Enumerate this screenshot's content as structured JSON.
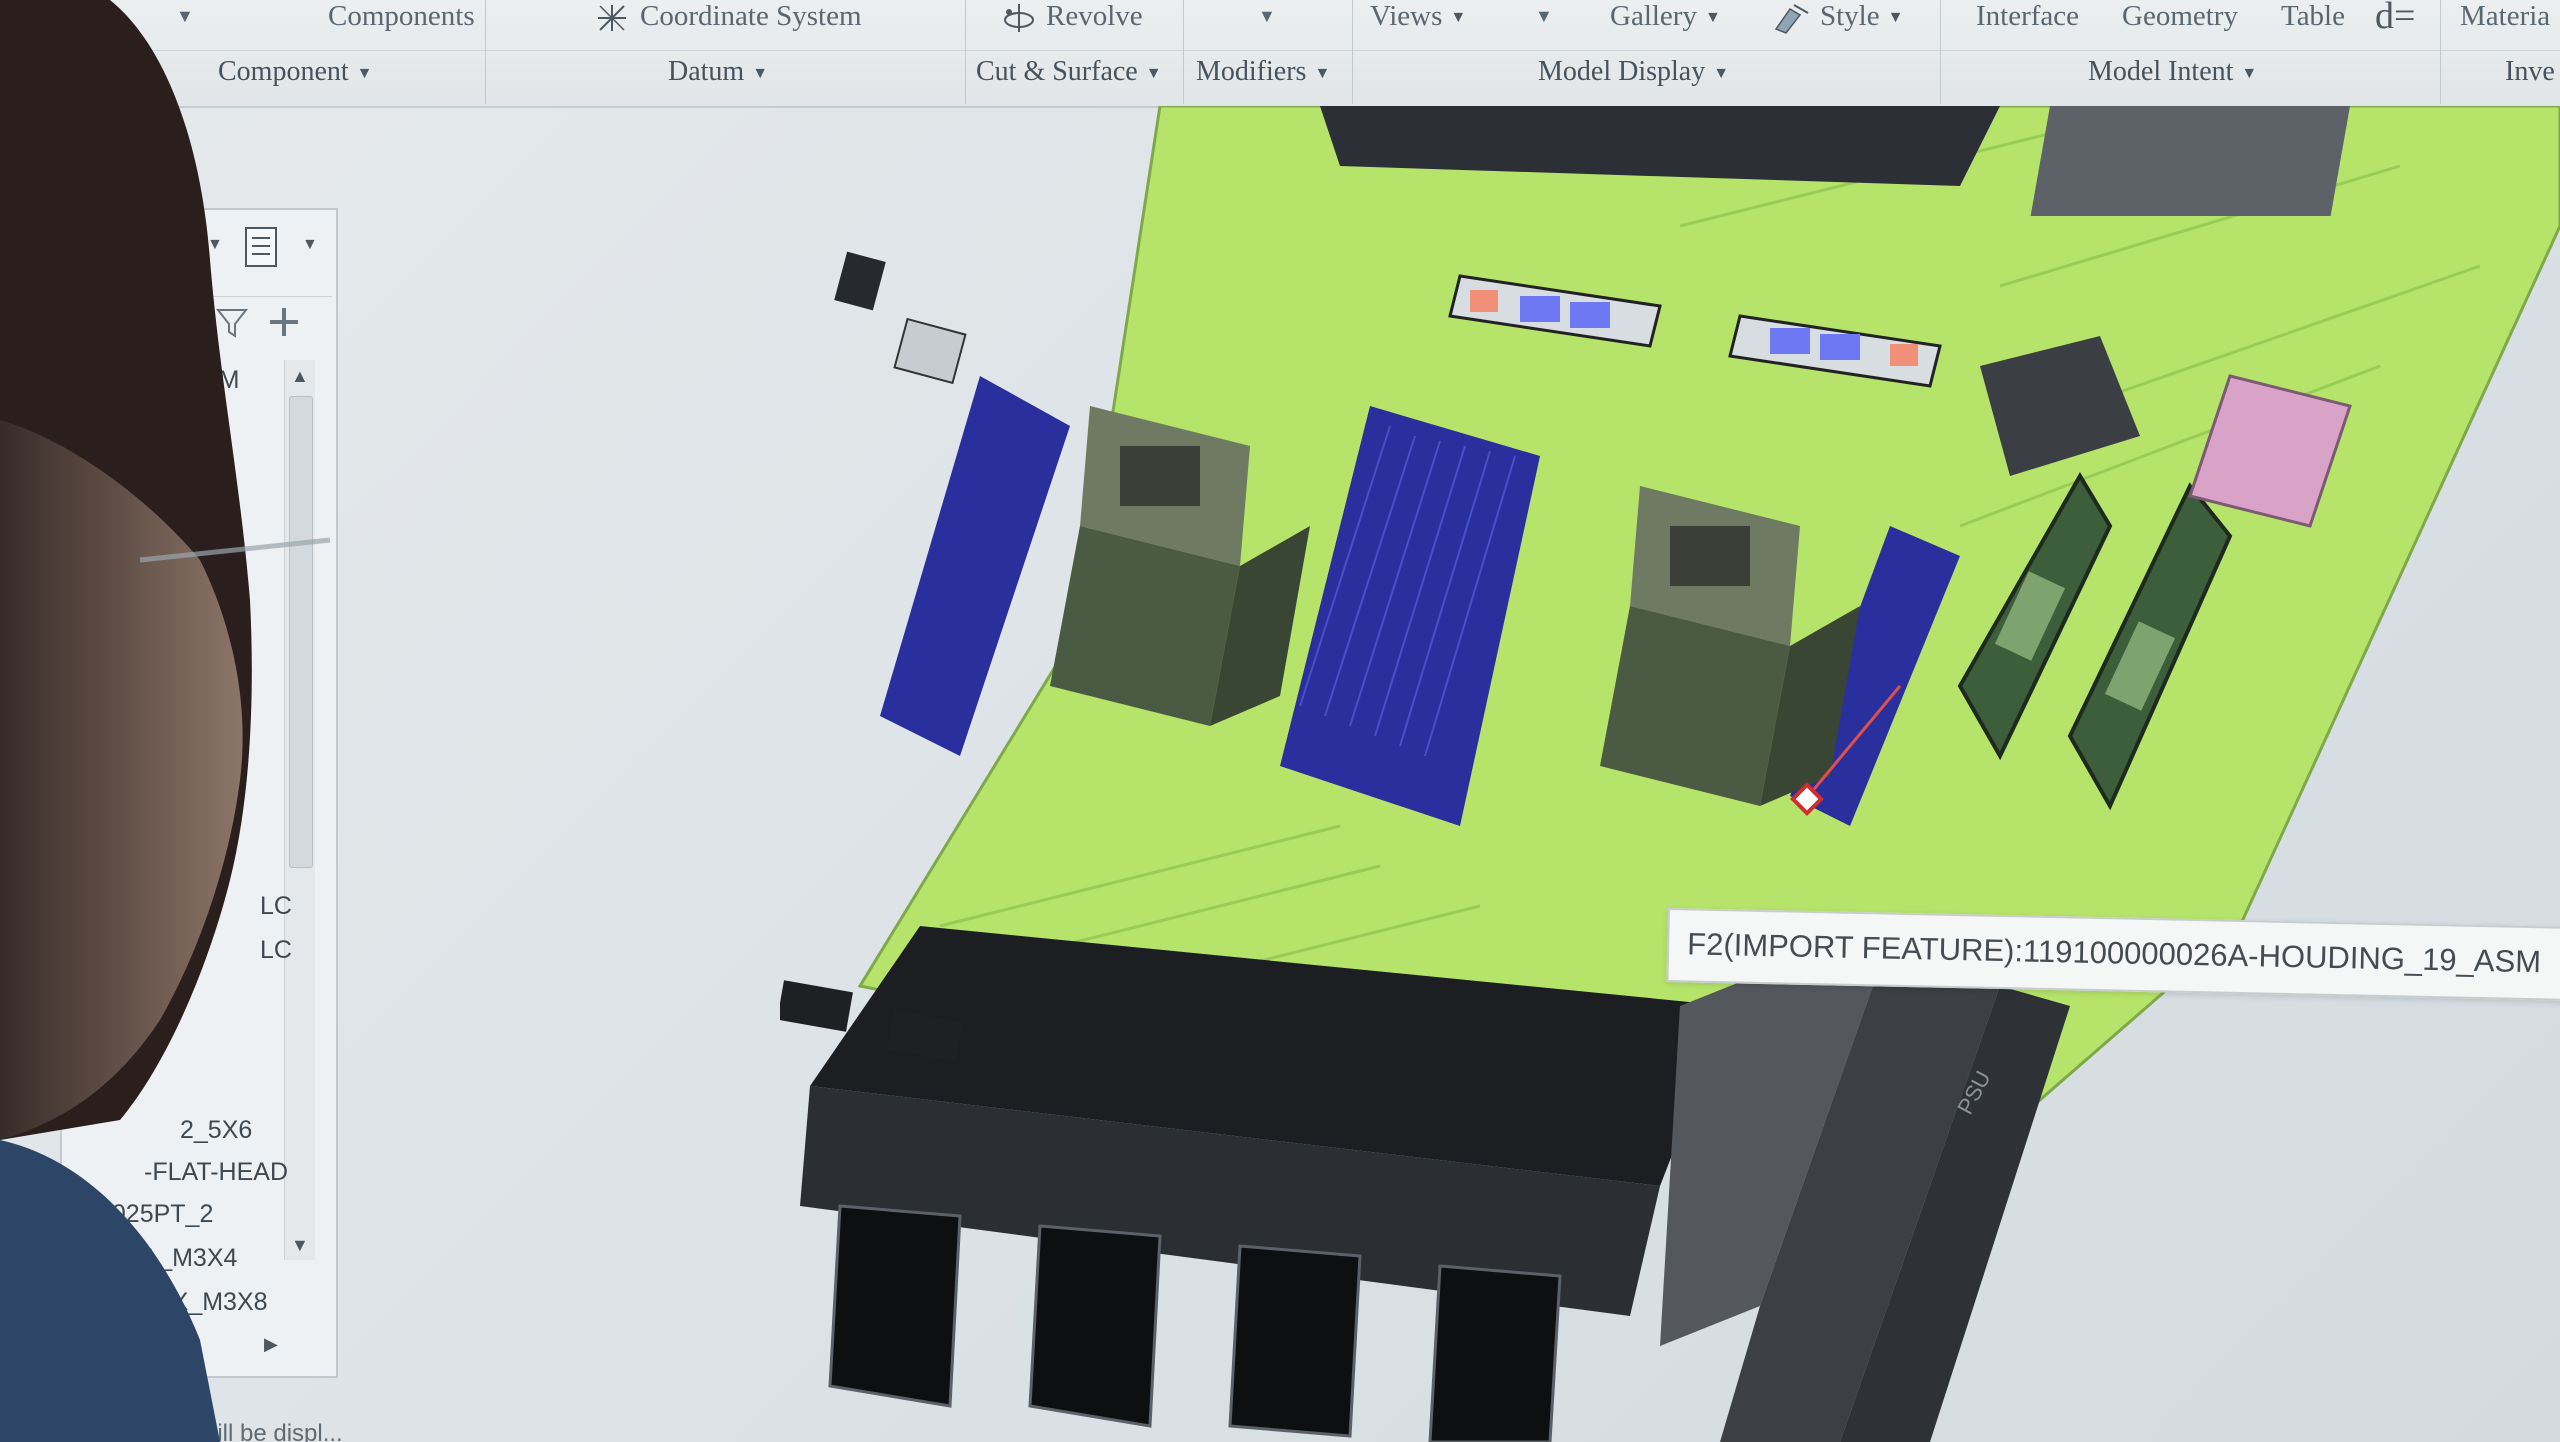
{
  "ribbon": {
    "row1": {
      "components": "Components",
      "coordinate_system": "Coordinate System",
      "revolve": "Revolve",
      "views": "Views",
      "gallery": "Gallery",
      "style": "Style",
      "interface": "Interface",
      "geometry": "Geometry",
      "table": "Table",
      "materials": "Materia"
    },
    "groups": {
      "component": "Component",
      "datum": "Datum",
      "cut_surface": "Cut & Surface",
      "modifiers": "Modifiers",
      "model_display": "Model Display",
      "model_intent": "Model Intent",
      "investigate": "Inve"
    }
  },
  "graphics_toolbar": {
    "buttons": [
      "refit",
      "zoom-in",
      "zoom-out",
      "repaint",
      "saved-orientations",
      "annotation-display",
      "view-manager",
      "datum-display",
      "spin-center",
      "perspective"
    ]
  },
  "model_tree": {
    "items": {
      "top": "SM",
      "tail_lc_1": "LC",
      "tail_lc_2": "LC",
      "screw_1": "2_5X6",
      "screw_2": "-FLAT-HEAD",
      "screw_3": "3025PT_2",
      "screw_4": "00019A_M3X4",
      "screw_5": "0002XXXX_M3X8"
    }
  },
  "tooltip": {
    "text": "F2(IMPORT FEATURE):119100000026A-HOUDING_19_ASM"
  },
  "status": {
    "text": "will be displ..."
  },
  "model": {
    "board_label": "PSU"
  },
  "colors": {
    "pcb_green": "#b6e36a",
    "dimm_blue": "#2a2f9e",
    "heatsink_dark": "#4b5a42",
    "fan_black": "#1c1e22"
  }
}
